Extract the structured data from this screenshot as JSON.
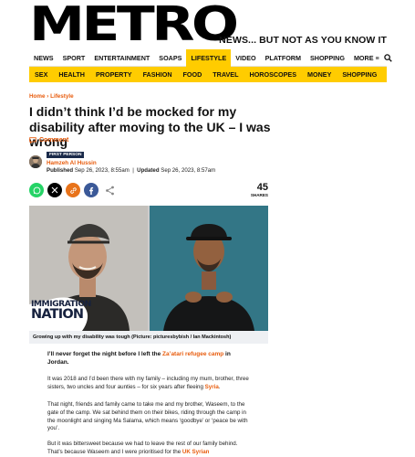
{
  "brand": {
    "logo": "METRO",
    "tagline": "NEWS... BUT NOT AS YOU KNOW IT",
    "accent": "#ffcc00",
    "link_color": "#e85c0d"
  },
  "nav_primary": [
    {
      "label": "NEWS"
    },
    {
      "label": "SPORT"
    },
    {
      "label": "ENTERTAINMENT"
    },
    {
      "label": "SOAPS"
    },
    {
      "label": "LIFESTYLE"
    },
    {
      "label": "VIDEO"
    },
    {
      "label": "PLATFORM"
    },
    {
      "label": "SHOPPING"
    },
    {
      "label": "MORE ≡"
    }
  ],
  "nav_secondary": [
    {
      "label": "SEX"
    },
    {
      "label": "HEALTH"
    },
    {
      "label": "PROPERTY"
    },
    {
      "label": "FASHION"
    },
    {
      "label": "FOOD"
    },
    {
      "label": "TRAVEL"
    },
    {
      "label": "HOROSCOPES"
    },
    {
      "label": "MONEY"
    },
    {
      "label": "SHOPPING"
    }
  ],
  "breadcrumb": {
    "home": "Home",
    "sep": " › ",
    "section": "Lifestyle"
  },
  "article": {
    "headline": "I didn’t think I’d be mocked for my disability after moving to the UK – I was wrong",
    "comment_label": "Comment",
    "author_tag": "FIRST PERSON",
    "author_name": "Hamzeh Al Hussin",
    "published_label": "Published",
    "published_date": "Sep 26, 2023, 8:55am",
    "separator": "|",
    "updated_label": "Updated",
    "updated_date": "Sep 26, 2023, 8:57am",
    "share_count": "45",
    "share_label": "SHARES",
    "photo_badge_line1": "IMMIGRATION",
    "photo_badge_line2": "NATION",
    "caption": "Growing up with my disability was tough (Picture: picturesbybish / Ian Mackintosh)",
    "p1_a": "I’ll never forget the night before I left the ",
    "p1_link": "Za’atari refugee camp",
    "p1_b": " in Jordan.",
    "p2_a": "It was 2018 and I’d been there with my family – including my mum, brother, three sisters, two uncles and four aunties – for six years after fleeing ",
    "p2_link": "Syria",
    "p2_b": ".",
    "p3": "That night, friends and family came to take me and my brother, Waseem, to the gate of the camp. We sat behind them on their bikes, riding through the camp in the moonlight and singing Ma Salama, which means ‘goodbye’ or ‘peace be with you’.",
    "p4_a": "But it was bittersweet because we had to leave the rest of our family behind. That’s because Waseem and I were prioritised for the ",
    "p4_link": "UK Syrian"
  }
}
